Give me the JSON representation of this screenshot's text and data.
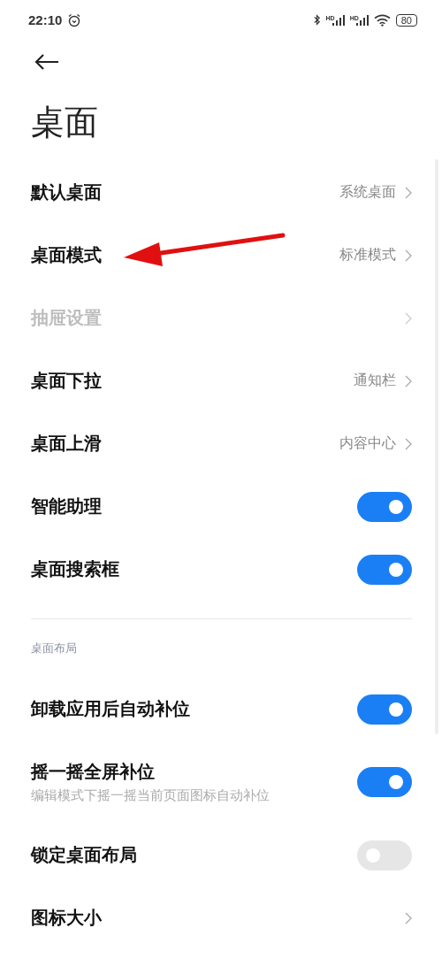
{
  "status_bar": {
    "time": "22:10",
    "signals": [
      {
        "label": "HD"
      },
      {
        "label": "HD"
      }
    ],
    "battery": "80"
  },
  "title": "桌面",
  "groups": [
    {
      "items": [
        {
          "kind": "link",
          "label": "默认桌面",
          "value": "系统桌面",
          "disabled": false
        },
        {
          "kind": "link",
          "label": "桌面模式",
          "value": "标准模式",
          "disabled": false
        },
        {
          "kind": "link",
          "label": "抽屉设置",
          "disabled": true
        },
        {
          "kind": "link",
          "label": "桌面下拉",
          "value": "通知栏",
          "disabled": false
        },
        {
          "kind": "link",
          "label": "桌面上滑",
          "value": "内容中心",
          "disabled": false
        },
        {
          "kind": "toggle",
          "label": "智能助理",
          "on": true
        },
        {
          "kind": "toggle",
          "label": "桌面搜索框",
          "on": true
        }
      ]
    },
    {
      "header": "桌面布局",
      "items": [
        {
          "kind": "toggle",
          "label": "卸载应用后自动补位",
          "on": true
        },
        {
          "kind": "toggle",
          "label": "摇一摇全屏补位",
          "subtitle": "编辑模式下摇一摇当前页面图标自动补位",
          "on": true
        },
        {
          "kind": "toggle",
          "label": "锁定桌面布局",
          "on": false
        },
        {
          "kind": "link",
          "label": "图标大小",
          "disabled": false
        }
      ]
    }
  ]
}
